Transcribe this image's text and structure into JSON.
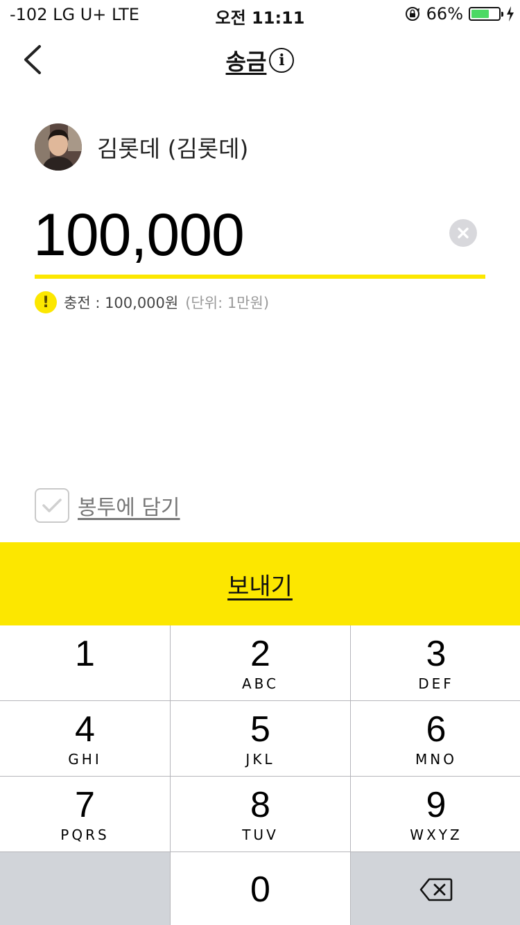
{
  "status_bar": {
    "carrier": "-102 LG U+   LTE",
    "time": "오전 11:11",
    "battery_percent": "66%",
    "battery_level": 0.66,
    "battery_color": "#4cd964"
  },
  "nav": {
    "back_icon": "chevron-left-icon",
    "title": "송금",
    "info_icon_text": "i"
  },
  "recipient": {
    "name": "김롯데 (김롯데)"
  },
  "amount": {
    "value": "100,000",
    "clear_icon": "clear-circle-icon"
  },
  "charge_note": {
    "icon_text": "!",
    "text": "충전 : 100,000원",
    "unit": "(단위: 1만원)"
  },
  "envelope": {
    "label": "봉투에 담기",
    "checked": false
  },
  "send_button": {
    "label": "보내기",
    "color": "#fce700"
  },
  "keypad": {
    "keys": [
      {
        "digit": "1",
        "letters": ""
      },
      {
        "digit": "2",
        "letters": "ABC"
      },
      {
        "digit": "3",
        "letters": "DEF"
      },
      {
        "digit": "4",
        "letters": "GHI"
      },
      {
        "digit": "5",
        "letters": "JKL"
      },
      {
        "digit": "6",
        "letters": "MNO"
      },
      {
        "digit": "7",
        "letters": "PQRS"
      },
      {
        "digit": "8",
        "letters": "TUV"
      },
      {
        "digit": "9",
        "letters": "WXYZ"
      },
      {
        "digit": "0",
        "letters": ""
      }
    ],
    "delete_icon": "backspace-icon"
  }
}
